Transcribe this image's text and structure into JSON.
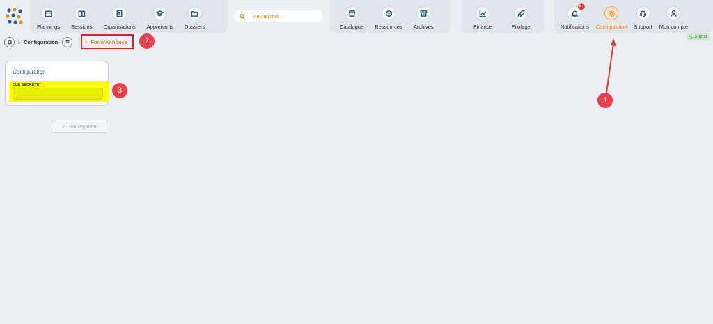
{
  "nav": {
    "group1": [
      {
        "label": "Plannings",
        "icon": "calendar-icon"
      },
      {
        "label": "Sessions",
        "icon": "book-icon"
      },
      {
        "label": "Organisations",
        "icon": "building-icon"
      },
      {
        "label": "Apprenants",
        "icon": "graduation-cap-icon"
      },
      {
        "label": "Dossiers",
        "icon": "folder-icon"
      }
    ],
    "search_placeholder": "Rechercher",
    "group2": [
      {
        "label": "Catalogue",
        "icon": "store-icon"
      },
      {
        "label": "Ressources",
        "icon": "cube-icon"
      },
      {
        "label": "Archives",
        "icon": "archive-icon"
      }
    ],
    "group3": [
      {
        "label": "Finance",
        "icon": "chart-line-icon"
      },
      {
        "label": "Pilotage",
        "icon": "rocket-icon"
      }
    ],
    "group4": [
      {
        "label": "Notifications",
        "icon": "bell-icon",
        "badge": "57"
      },
      {
        "label": "Configuration",
        "icon": "gear-icon"
      },
      {
        "label": "Support",
        "icon": "headset-icon"
      },
      {
        "label": "Mon compte",
        "icon": "user-icon"
      }
    ]
  },
  "version": "5.12.11",
  "breadcrumb": {
    "section": "Configuration",
    "current": "Form'Annonce"
  },
  "card": {
    "title": "Configuration",
    "field_label": "CLÉ SECRÈTE*",
    "field_value": ""
  },
  "save_label": "Sauvegarder",
  "markers": {
    "m1": "1",
    "m2": "2",
    "m3": "3"
  },
  "colors": {
    "accent": "#ef8a1f",
    "primary": "#2a5d8a",
    "highlight": "#ffff00",
    "marker": "#e9414a"
  }
}
